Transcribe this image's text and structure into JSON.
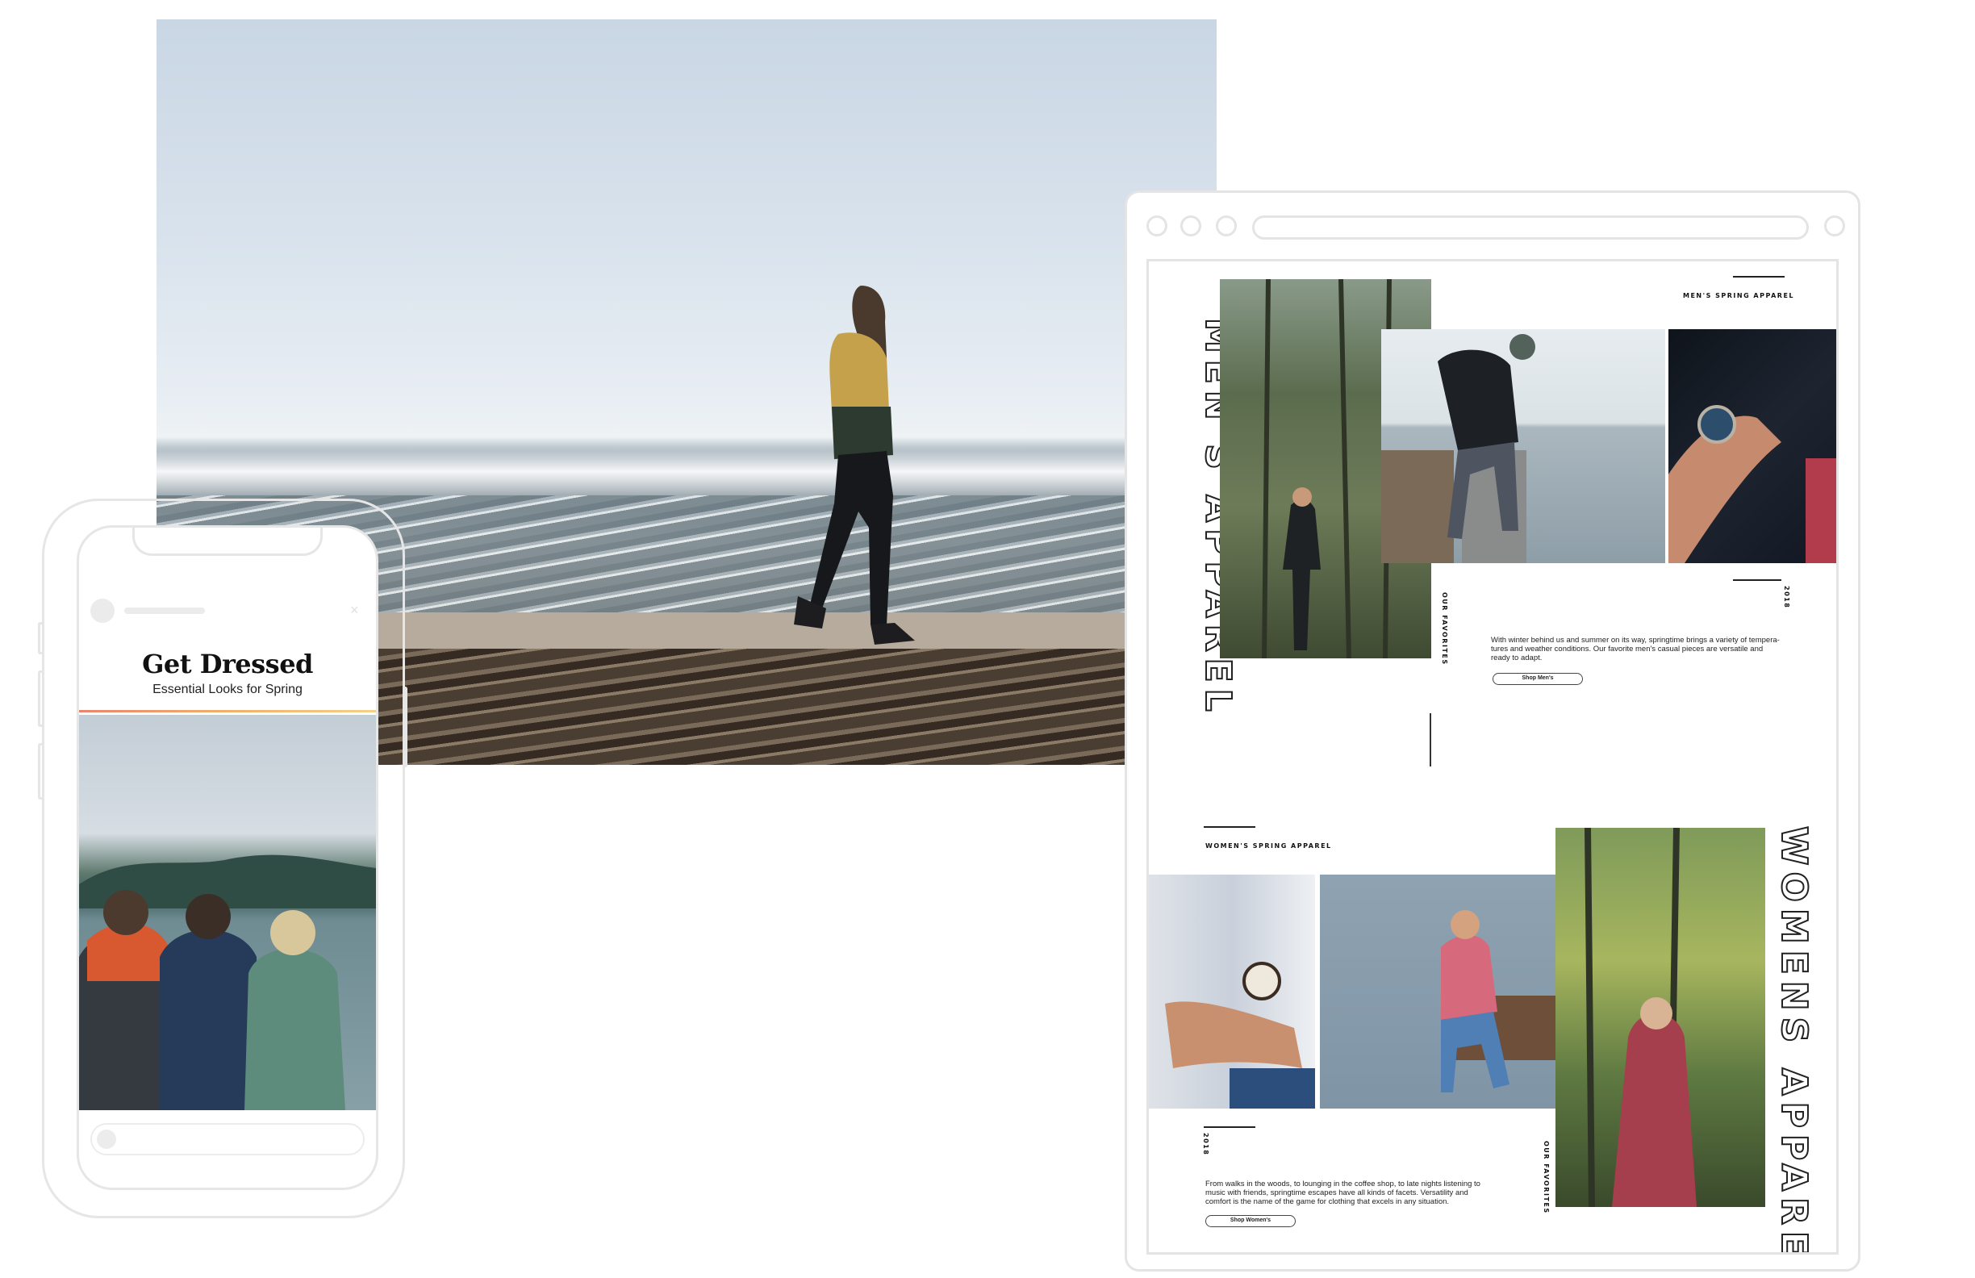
{
  "phone": {
    "title": "Get Dressed",
    "subtitle": "Essential Looks for Spring"
  },
  "mens": {
    "vertical_title": "MEN'S APPAREL",
    "heading": "MEN'S SPRING APPAREL",
    "side_label": "OUR FAVORITES",
    "year": "2018",
    "body": "With winter behind us and summer on its way, springtime brings a variety of tempera-tures and weather conditions. Our favorite men's casual pieces are versatile and ready to adapt.",
    "button": "Shop Men's"
  },
  "womens": {
    "vertical_title": "WOMENS APPAREL",
    "heading": "WOMEN'S SPRING APPAREL",
    "side_label": "OUR FAVORITES",
    "year": "2018",
    "body": "From walks in the woods, to lounging in the coffee shop, to late nights listening to music with friends, springtime escapes have all kinds of facets. Versatility and comfort is the name of the game for clothing that excels in any situation.",
    "button": "Shop Women's"
  },
  "colors": {
    "accent_gradient_start": "#e9846f",
    "accent_gradient_end": "#f5d08a",
    "mockup_outline": "#e4e4e4"
  }
}
